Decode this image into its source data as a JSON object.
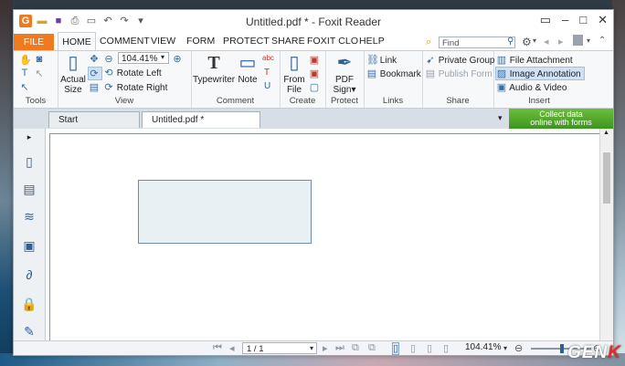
{
  "window": {
    "title": "Untitled.pdf * - Foxit Reader"
  },
  "menu": {
    "file": "FILE",
    "tabs": [
      "HOME",
      "COMMENT",
      "VIEW",
      "FORM",
      "PROTECT",
      "SHARE",
      "FOXIT CLO",
      "HELP"
    ]
  },
  "search": {
    "placeholder": "Find"
  },
  "ribbon": {
    "groups": {
      "tools": "Tools",
      "view": "View",
      "comment": "Comment",
      "create": "Create",
      "protect": "Protect",
      "links": "Links",
      "share": "Share",
      "insert": "Insert"
    },
    "view": {
      "actual_size_1": "Actual",
      "actual_size_2": "Size",
      "zoom": "104.41%",
      "rotate_left": "Rotate Left",
      "rotate_right": "Rotate Right"
    },
    "comment": {
      "typewriter": "Typewriter",
      "note": "Note"
    },
    "create": {
      "from_file_1": "From",
      "from_file_2": "File"
    },
    "protect": {
      "pdf_sign_1": "PDF",
      "pdf_sign_2": "Sign"
    },
    "links": {
      "link": "Link",
      "bookmark": "Bookmark"
    },
    "share": {
      "private_group": "Private Group",
      "publish_form": "Publish Form"
    },
    "insert": {
      "file_attachment": "File Attachment",
      "image_annotation": "Image Annotation",
      "audio_video": "Audio & Video"
    }
  },
  "doc_tabs": [
    {
      "label": "Start"
    },
    {
      "label": "Untitled.pdf *"
    }
  ],
  "promo": {
    "line1": "Collect data",
    "line2": "online with forms"
  },
  "status": {
    "page": "1 / 1",
    "zoom": "104.41%"
  },
  "watermark": {
    "text": "GEN",
    "accent": "K"
  },
  "colors": {
    "accent": "#f07b1e",
    "annotation_fill": "#e8f0f3",
    "annotation_border": "#6e8ca8"
  }
}
